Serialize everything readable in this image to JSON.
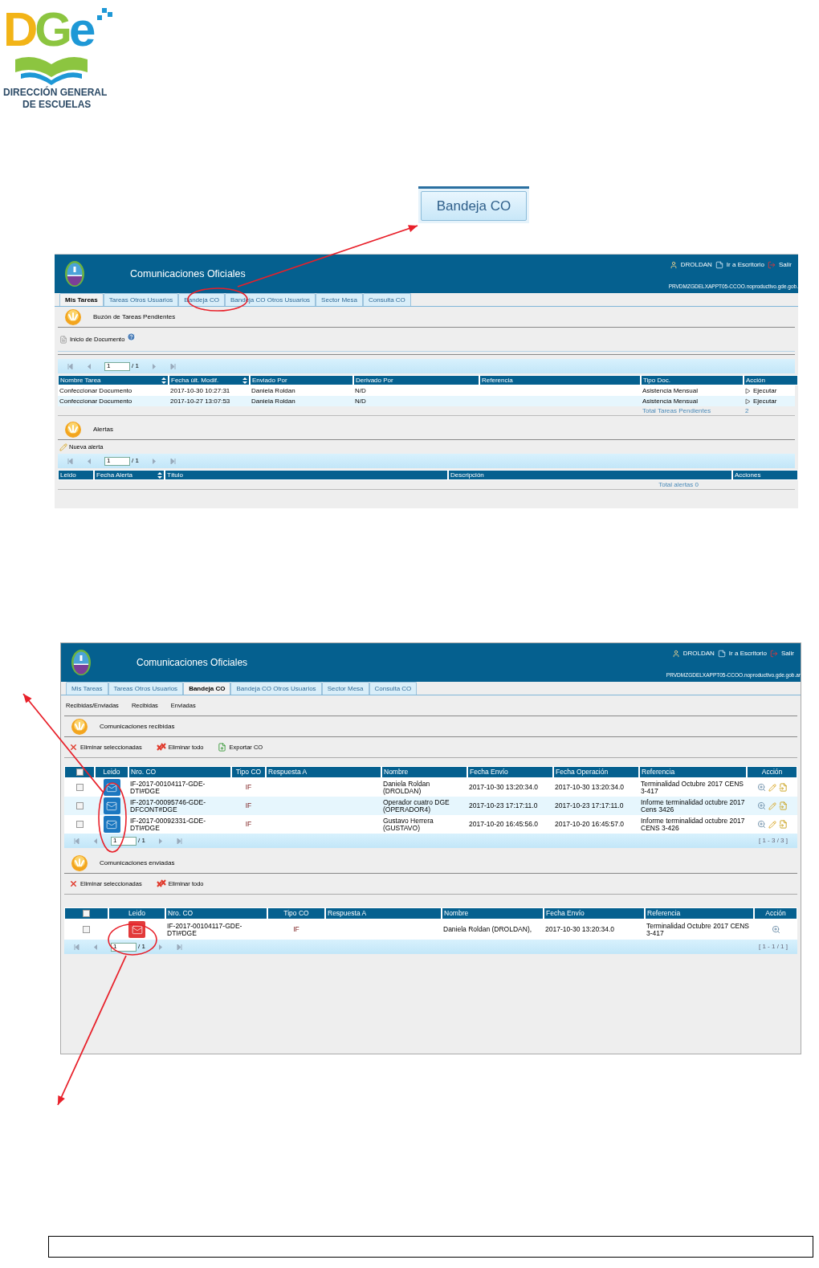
{
  "logo": {
    "letters": [
      {
        "text": "D",
        "color": "#f2b417"
      },
      {
        "text": "G",
        "color": "#8cc540"
      },
      {
        "text": "e",
        "color": "#1e98d6"
      }
    ],
    "line_1": "DIRECCIÓN GENERAL",
    "line_2": "DE ESCUELAS"
  },
  "callout_button": {
    "label": "Bandeja CO"
  },
  "tareas_screen": {
    "header": {
      "title": "Comunicaciones Oficiales",
      "user": "DROLDAN",
      "desktop_link": "Ir a Escritorio",
      "logout_link": "Salir",
      "server": "PRVDMZGDELXAPPT05-CCOO.noproductivo.gde.gob."
    },
    "tabs": [
      {
        "label": "Mis Tareas",
        "selected": true
      },
      {
        "label": "Tareas Otros Usuarios",
        "selected": false
      },
      {
        "label": "Bandeja CO",
        "selected": false
      },
      {
        "label": "Bandeja CO Otros Usuarios",
        "selected": false
      },
      {
        "label": "Sector Mesa",
        "selected": false
      },
      {
        "label": "Consulta CO",
        "selected": false
      }
    ],
    "pending": {
      "title": "Buzón de Tareas Pendientes",
      "start_link": "Inicio de Documento",
      "pager": {
        "page": "1",
        "of": "/ 1"
      },
      "columns": [
        {
          "label": "Nombre Tarea",
          "sortable": true
        },
        {
          "label": "Fecha últ. Modif.",
          "sortable": true
        },
        {
          "label": "Enviado Por",
          "sortable": false
        },
        {
          "label": "Derivado Por",
          "sortable": false
        },
        {
          "label": "Referencia",
          "sortable": false
        },
        {
          "label": "Tipo Doc.",
          "sortable": false
        },
        {
          "label": "Acción",
          "sortable": false
        }
      ],
      "rows": [
        {
          "task": "Confeccionar Documento",
          "modified": "2017-10-30 10:27:31",
          "sent_by": "Daniela Roldan",
          "derived_by": "N/D",
          "doc_type": "Asistencia Mensual",
          "action": "Ejecutar"
        },
        {
          "task": "Confeccionar Documento",
          "modified": "2017-10-27 13:07:53",
          "sent_by": "Daniela Roldan",
          "derived_by": "N/D",
          "doc_type": "Asistencia Mensual",
          "action": "Ejecutar"
        }
      ],
      "total_label": "Total Tareas Pendientes",
      "total": "2"
    },
    "alerts": {
      "title": "Alertas",
      "new_link": "Nueva alerta",
      "pager": {
        "page": "1",
        "of": "/ 1"
      },
      "columns": [
        {
          "label": "Leido",
          "sortable": false
        },
        {
          "label": "Fecha Alerta",
          "sortable": true
        },
        {
          "label": "Título",
          "sortable": false
        },
        {
          "label": "Descripción",
          "sortable": false
        },
        {
          "label": "Acciones",
          "sortable": false
        }
      ],
      "total": "Total alertas 0"
    }
  },
  "bandeja_screen": {
    "header": {
      "title": "Comunicaciones Oficiales",
      "user": "DROLDAN",
      "desktop_link": "Ir a Escritorio",
      "logout_link": "Salir",
      "server": "PRVDMZGDELXAPPT05-CCOO.noproductivo.gde.gob.ar"
    },
    "tabs": [
      {
        "label": "Mis Tareas",
        "selected": false
      },
      {
        "label": "Tareas Otros Usuarios",
        "selected": false
      },
      {
        "label": "Bandeja CO",
        "selected": true
      },
      {
        "label": "Bandeja CO Otros Usuarios",
        "selected": false
      },
      {
        "label": "Sector Mesa",
        "selected": false
      },
      {
        "label": "Consulta CO",
        "selected": false
      }
    ],
    "subtabs": [
      "Recibidas/Enviadas",
      "Recibidas",
      "Enviadas"
    ],
    "received": {
      "title": "Comunicaciones recibidas",
      "actions": [
        {
          "kind": "delete",
          "label": "Eliminar seleccionadas"
        },
        {
          "kind": "delete_all",
          "label": "Eliminar todo"
        },
        {
          "kind": "export",
          "label": "Exportar CO"
        }
      ],
      "select_all_checked": false,
      "columns": [
        "Leido",
        "Nro. CO",
        "Tipo CO",
        "Respuesta A",
        "Nombre",
        "Fecha Envío",
        "Fecha Operación",
        "Referencia",
        "Acción"
      ],
      "rows": [
        {
          "checked": false,
          "read": true,
          "number": "IF-2017-00104117-GDE-DTI#DGE",
          "type": "IF",
          "name": "Daniela Roldan (DROLDAN)",
          "sent": "2017-10-30 13:20:34.0",
          "operation": "2017-10-30 13:20:34.0",
          "reference": "Terminalidad Octubre 2017 CENS 3-417"
        },
        {
          "checked": false,
          "read": true,
          "number": "IF-2017-00095746-GDE-DFCONT#DGE",
          "type": "IF",
          "name": "Operador cuatro DGE (OPERADOR4)",
          "sent": "2017-10-23 17:17:11.0",
          "operation": "2017-10-23 17:17:11.0",
          "reference": "Informe terminalidad octubre 2017 Cens 3426"
        },
        {
          "checked": false,
          "read": true,
          "number": "IF-2017-00092331-GDE-DTI#DGE",
          "type": "IF",
          "name": "Gustavo Herrera (GUSTAVO)",
          "sent": "2017-10-20 16:45:56.0",
          "operation": "2017-10-20 16:45:57.0",
          "reference": "Informe terminalidad octubre 2017 CENS 3-426"
        }
      ],
      "pager": {
        "page": "1",
        "of": "/ 1",
        "range": "[ 1 - 3 / 3 ]"
      }
    },
    "sent": {
      "title": "Comunicaciones enviadas",
      "actions": [
        {
          "kind": "delete",
          "label": "Eliminar seleccionadas"
        },
        {
          "kind": "delete_all",
          "label": "Eliminar todo"
        }
      ],
      "select_all_checked": false,
      "columns": [
        "Leido",
        "Nro. CO",
        "Tipo CO",
        "Respuesta A",
        "Nombre",
        "Fecha Envío",
        "Referencia",
        "Acción"
      ],
      "rows": [
        {
          "checked": false,
          "read": false,
          "number": "IF-2017-00104117-GDE-DTI#DGE",
          "type": "IF",
          "name": "Daniela Roldan (DROLDAN),",
          "sent": "2017-10-30 13:20:34.0",
          "reference": "Terminalidad Octubre 2017 CENS 3-417"
        }
      ],
      "pager": {
        "page": "1",
        "of": "/ 1",
        "range": "[ 1 - 1 / 1 ]"
      }
    }
  }
}
